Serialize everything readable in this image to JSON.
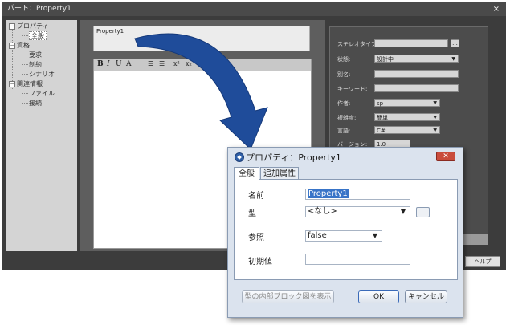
{
  "back_window": {
    "title": "パート：Property1",
    "close": "×",
    "tree": {
      "items": [
        {
          "label": "プロパティ",
          "level": 0,
          "expander": "−"
        },
        {
          "label": "全般",
          "level": 1,
          "selected": true
        },
        {
          "label": "資格",
          "level": 0,
          "expander": "−"
        },
        {
          "label": "要求",
          "level": 1
        },
        {
          "label": "制約",
          "level": 1
        },
        {
          "label": "シナリオ",
          "level": 1
        },
        {
          "label": "関連情報",
          "level": 0,
          "expander": "−"
        },
        {
          "label": "ファイル",
          "level": 1
        },
        {
          "label": "接続",
          "level": 1
        }
      ]
    },
    "center": {
      "property_input_value": "Property1",
      "toolbar": {
        "bold": "B",
        "italic": "I",
        "underline": "U",
        "font_color": "A",
        "bullets": "☰",
        "numbers": "☰",
        "superscript": "x²",
        "subscript": "x₂"
      }
    },
    "right_panel": {
      "fields": [
        {
          "label": "ステレオタイプ:",
          "value": "",
          "button": "..."
        },
        {
          "label": "状態:",
          "value": "設計中"
        },
        {
          "label": "別名:",
          "value": ""
        },
        {
          "label": "キーワード:",
          "value": ""
        },
        {
          "label": "作者:",
          "value": "sp"
        },
        {
          "label": "複雑度:",
          "value": "簡単"
        },
        {
          "label": "言語:",
          "value": "C#"
        },
        {
          "label": "バージョン:",
          "value": "1.0"
        }
      ]
    },
    "help_button": "ヘルプ"
  },
  "dialog": {
    "title": "プロパティ：Property1",
    "close": "✕",
    "tabs": [
      {
        "label": "全般",
        "active": true
      },
      {
        "label": "追加属性",
        "active": false
      }
    ],
    "fields": {
      "name": {
        "label": "名前",
        "value": "Property1"
      },
      "type": {
        "label": "型",
        "value": "<なし>",
        "button": "..."
      },
      "reference": {
        "label": "参照",
        "value": "false"
      },
      "initial": {
        "label": "初期値",
        "value": ""
      }
    },
    "buttons": {
      "show_block": "型の内部ブロック図を表示",
      "ok": "OK",
      "cancel": "キャンセル"
    }
  },
  "colors": {
    "arrow": "#1f4c9a",
    "dialog_bg": "#dbe3ee",
    "selection": "#3874c8",
    "close_red": "#c94c3c"
  },
  "icons": {
    "dialog": "property-icon",
    "arrow": "curved-arrow-icon"
  }
}
